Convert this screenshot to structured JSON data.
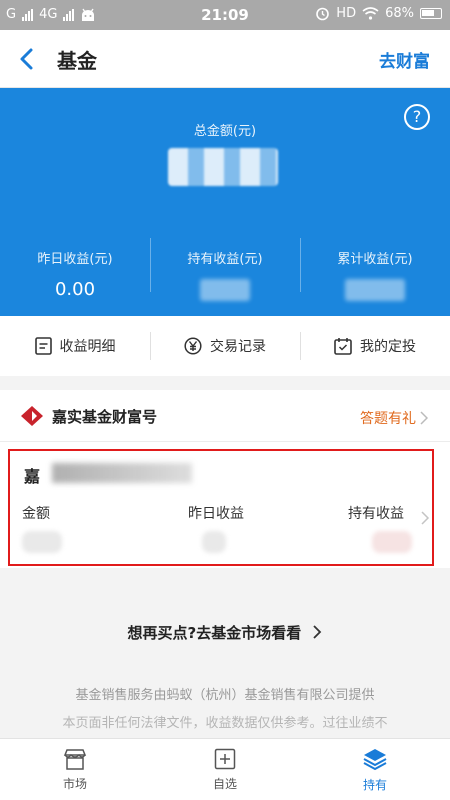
{
  "status_bar": {
    "carrier1": "G",
    "carrier2": "4G",
    "time": "21:09",
    "hd": "HD",
    "battery": "68%"
  },
  "nav": {
    "title": "基金",
    "right_link": "去财富"
  },
  "summary": {
    "total_label": "总金额(元)",
    "help_glyph": "?",
    "stats": [
      {
        "label": "昨日收益(元)",
        "value": "0.00"
      },
      {
        "label": "持有收益(元)",
        "value": ""
      },
      {
        "label": "累计收益(元)",
        "value": ""
      }
    ]
  },
  "actions": [
    {
      "label": "收益明细",
      "icon": "list-icon"
    },
    {
      "label": "交易记录",
      "icon": "yen-circle-icon"
    },
    {
      "label": "我的定投",
      "icon": "calendar-icon"
    }
  ],
  "brand": {
    "name": "嘉实基金财富号",
    "link": "答题有礼"
  },
  "fund_card": {
    "name_visible": "嘉",
    "columns": [
      "金额",
      "昨日收益",
      "持有收益"
    ]
  },
  "market_link": "想再买点?去基金市场看看",
  "disclaimer_line1": "基金销售服务由蚂蚁（杭州）基金销售有限公司提供",
  "disclaimer_line2": "本页面非任何法律文件，收益数据仅供参考。过往业绩不",
  "tabs": [
    {
      "label": "市场",
      "icon": "store-icon"
    },
    {
      "label": "自选",
      "icon": "add-box-icon"
    },
    {
      "label": "持有",
      "icon": "layers-icon"
    }
  ],
  "colors": {
    "accent": "#1b86dd",
    "link_blue": "#1a7cd8",
    "orange": "#e06a1e",
    "highlight_red": "#e11b1b"
  }
}
